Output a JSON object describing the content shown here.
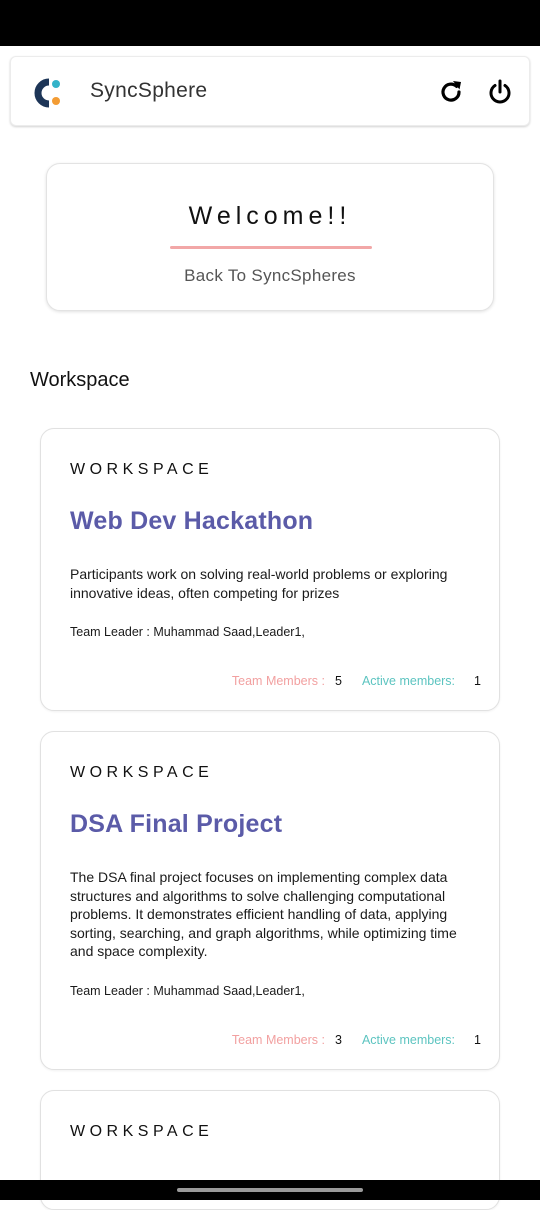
{
  "app": {
    "title": "SyncSphere",
    "colors": {
      "logo_dark": "#1d3557",
      "logo_dot_teal": "#34b3c9",
      "logo_dot_orange": "#f39c34",
      "accent_purple": "#5b5ba8",
      "accent_pink": "#f2a0a0",
      "accent_teal": "#5cc4c0"
    }
  },
  "header": {
    "refresh_icon": "refresh-icon",
    "power_icon": "power-icon"
  },
  "welcome": {
    "title": "Welcome!!",
    "subtitle": "Back To SyncSpheres"
  },
  "section": {
    "title": "Workspace"
  },
  "workspaces": [
    {
      "label": "WORKSPACE",
      "title": "Web Dev Hackathon",
      "description": "Participants work on solving real-world problems or exploring innovative ideas, often competing for prizes",
      "leader": "Team Leader : Muhammad Saad,Leader1,",
      "team_members_label": "Team Members :",
      "team_members": "5",
      "active_members_label": "Active members:",
      "active_members": "1"
    },
    {
      "label": "WORKSPACE",
      "title": "DSA Final Project",
      "description": "The DSA final project focuses on implementing complex data structures and algorithms to solve challenging computational problems. It demonstrates efficient handling of data, applying sorting, searching, and graph algorithms, while optimizing time and space complexity.",
      "leader": "Team Leader : Muhammad Saad,Leader1,",
      "team_members_label": "Team Members :",
      "team_members": "3",
      "active_members_label": "Active members:",
      "active_members": "1"
    },
    {
      "label": "WORKSPACE"
    }
  ]
}
